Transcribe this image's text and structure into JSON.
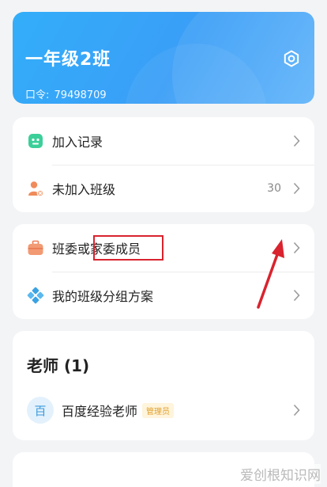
{
  "header": {
    "class_name": "一年级2班",
    "passcode_label": "口令:",
    "passcode_value": "79498709"
  },
  "menu_group1": [
    {
      "label": "加入记录",
      "icon": "record-icon",
      "count": ""
    },
    {
      "label": "未加入班级",
      "icon": "person-unjoined-icon",
      "count": "30"
    }
  ],
  "menu_group2": [
    {
      "label": "班委或家委成员",
      "icon": "briefcase-icon"
    },
    {
      "label": "我的班级分组方案",
      "icon": "group-plan-icon"
    }
  ],
  "teachers": {
    "title": "老师 (1)",
    "list": [
      {
        "avatar_text": "百",
        "name": "百度经验老师",
        "role_badge": "管理员"
      }
    ]
  },
  "watermark": "爱创根知识网",
  "colors": {
    "header_gradient_start": "#33aef9",
    "header_gradient_end": "#5fb3fa",
    "annotation_red": "#d9232e",
    "badge_text": "#e0a12c"
  }
}
